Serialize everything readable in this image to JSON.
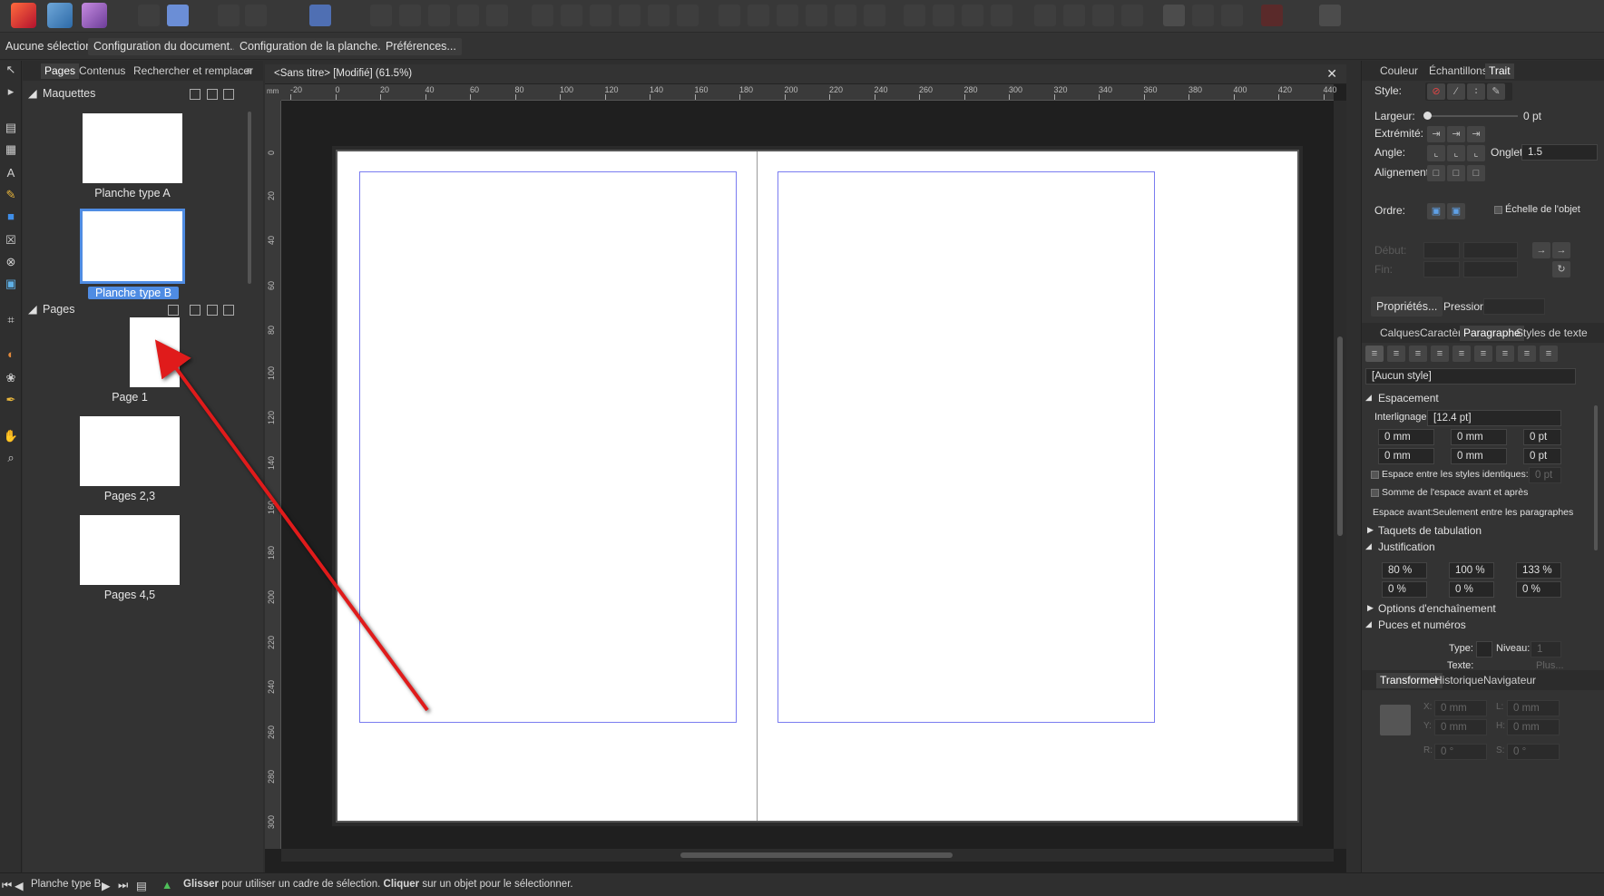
{
  "context_bar": {
    "selection": "Aucune sélection",
    "doc_setup": "Configuration du document...",
    "spread_setup": "Configuration de la planche...",
    "preferences": "Préférences..."
  },
  "left_panel": {
    "tabs": [
      "Pages",
      "Contenus",
      "Rechercher et remplacer"
    ],
    "masters_title": "Maquettes",
    "masters": [
      "Planche type A",
      "Planche type B"
    ],
    "pages_title": "Pages",
    "pages": [
      "Page 1",
      "Pages 2,3",
      "Pages 4,5"
    ]
  },
  "document": {
    "tab_title": "<Sans titre> [Modifié] (61.5%)",
    "ruler_unit": "mm",
    "h_ticks": [
      "-20",
      "0",
      "20",
      "40",
      "60",
      "80",
      "100",
      "120",
      "140",
      "160",
      "180",
      "200",
      "220",
      "240",
      "260",
      "280",
      "300",
      "320",
      "340",
      "360",
      "380",
      "400",
      "420",
      "440"
    ],
    "v_ticks": [
      "0",
      "20",
      "40",
      "60",
      "80",
      "100",
      "120",
      "140",
      "160",
      "180",
      "200",
      "220",
      "240",
      "260",
      "280",
      "300"
    ]
  },
  "stroke_panel": {
    "tabs": [
      "Couleur",
      "Échantillons",
      "Trait"
    ],
    "style_label": "Style:",
    "width_label": "Largeur:",
    "width_value": "0 pt",
    "cap_label": "Extrémité:",
    "join_label": "Angle:",
    "miter_label": "Onglet:",
    "miter_value": "1.5",
    "align_label": "Alignement:",
    "order_label": "Ordre:",
    "scale_label": "Échelle de l'objet",
    "start_label": "Début:",
    "end_label": "Fin:",
    "properties_btn": "Propriétés...",
    "pressure_label": "Pression:"
  },
  "paragraph_panel": {
    "tabs": [
      "Calques",
      "Caractère",
      "Paragraphe",
      "Styles de texte"
    ],
    "style_value": "[Aucun style]",
    "spacing_title": "Espacement",
    "leading_label": "Interlignage:",
    "leading_value": "[12.4 pt]",
    "indent_left": "0 mm",
    "indent_right": "0 mm",
    "space_before_pt": "0 pt",
    "first_line": "0 mm",
    "indent_last": "0 mm",
    "space_after_pt": "0 pt",
    "same_style_label": "Espace entre les styles identiques:",
    "same_style_value": "0 pt",
    "sum_label": "Somme de l'espace avant et après",
    "space_before_label": "Espace avant:",
    "space_before_value": "Seulement entre les paragraphes",
    "tabs_title": "Taquets de tabulation",
    "justification_title": "Justification",
    "just_row1": [
      "80 %",
      "100 %",
      "133 %"
    ],
    "just_row2": [
      "0 %",
      "0 %",
      "0 %"
    ],
    "flow_title": "Options d'enchaînement",
    "bullets_title": "Puces et numéros",
    "type_label": "Type:",
    "level_label": "Niveau:",
    "level_value": "1",
    "text_label": "Texte:",
    "more_label": "Plus..."
  },
  "transform_panel": {
    "tabs": [
      "Transformer",
      "Historique",
      "Navigateur"
    ],
    "x": "0 mm",
    "y": "0 mm",
    "w": "0 mm",
    "h": "0 mm",
    "r": "0 °",
    "s": "0 °",
    "x_label": "X:",
    "y_label": "Y:",
    "w_label": "L:",
    "h_label": "H:",
    "r_label": "R:",
    "s_label": "S:"
  },
  "status": {
    "page_name": "Planche type B",
    "drag_bold": "Glisser",
    "drag_text": " pour utiliser un cadre de sélection. ",
    "click_bold": "Cliquer",
    "click_text": " sur un objet pour le sélectionner."
  },
  "colors": {
    "accent": "#4f8ce3",
    "margin_guide": "#7a7cf0",
    "arrow": "#e01b1b"
  }
}
